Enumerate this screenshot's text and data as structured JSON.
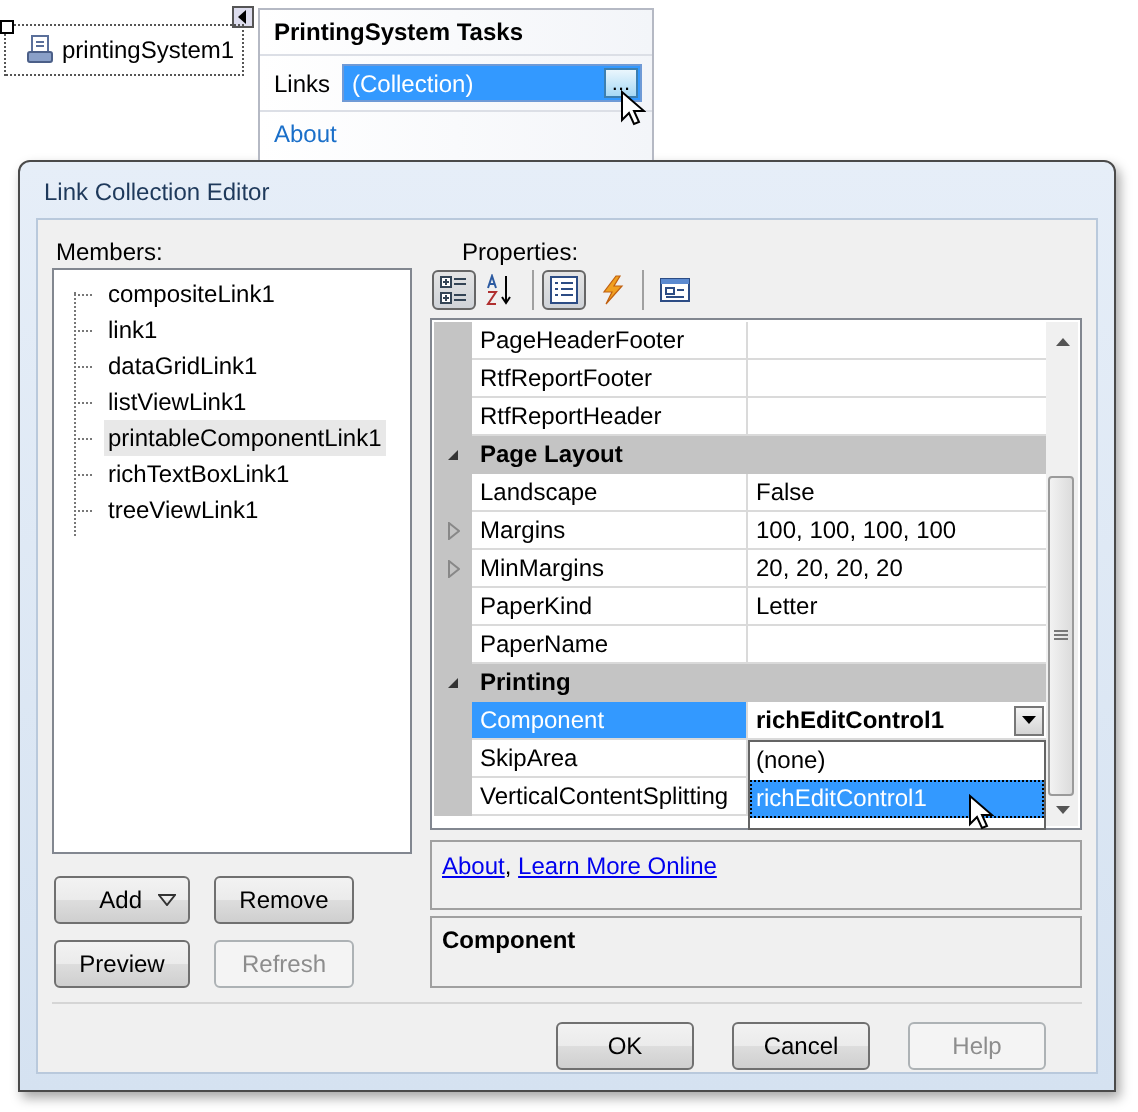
{
  "component_tray": {
    "label": "printingSystem1"
  },
  "smart_tag": {
    "title": "PrintingSystem Tasks",
    "links_label": "Links",
    "links_value": "(Collection)",
    "ellipsis": "...",
    "about_link": "About"
  },
  "dialog": {
    "title": "Link Collection Editor",
    "members_label": "Members:",
    "members": [
      {
        "label": "compositeLink1",
        "selected": false
      },
      {
        "label": "link1",
        "selected": false
      },
      {
        "label": "dataGridLink1",
        "selected": false
      },
      {
        "label": "listViewLink1",
        "selected": false
      },
      {
        "label": "printableComponentLink1",
        "selected": true
      },
      {
        "label": "richTextBoxLink1",
        "selected": false
      },
      {
        "label": "treeViewLink1",
        "selected": false
      }
    ],
    "member_buttons": [
      {
        "label": "Add",
        "kind": "split",
        "disabled": false
      },
      {
        "label": "Remove",
        "kind": "plain",
        "disabled": false
      },
      {
        "label": "Preview",
        "kind": "plain",
        "disabled": false
      },
      {
        "label": "Refresh",
        "kind": "plain",
        "disabled": true
      }
    ],
    "properties_label": "Properties:",
    "toolbar": [
      {
        "kind": "categorized",
        "selected": true
      },
      {
        "kind": "alphabetical",
        "selected": false
      },
      {
        "kind": "properties",
        "selected": true
      },
      {
        "kind": "events",
        "selected": false
      },
      {
        "kind": "property-pages",
        "selected": false
      }
    ],
    "grid": {
      "rows": [
        {
          "kind": "property",
          "name": "PageHeaderFooter",
          "expandable": false,
          "selected": false
        },
        {
          "kind": "property",
          "name": "RtfReportFooter",
          "expandable": false,
          "selected": false
        },
        {
          "kind": "property",
          "name": "RtfReportHeader",
          "expandable": false,
          "selected": false
        },
        {
          "kind": "category",
          "name": "Page Layout",
          "expanded": true
        },
        {
          "kind": "property",
          "name": "Landscape",
          "value": "False",
          "expandable": false,
          "selected": false,
          "modified": false
        },
        {
          "kind": "property",
          "name": "Margins",
          "value": "100, 100, 100, 100",
          "expandable": true,
          "selected": false,
          "modified": false
        },
        {
          "kind": "property",
          "name": "MinMargins",
          "value": "20, 20, 20, 20",
          "expandable": true,
          "selected": false,
          "modified": false
        },
        {
          "kind": "property",
          "name": "PaperKind",
          "value": "Letter",
          "expandable": false,
          "selected": false,
          "modified": false
        },
        {
          "kind": "property",
          "name": "PaperName",
          "expandable": false,
          "selected": false
        },
        {
          "kind": "category",
          "name": "Printing",
          "expanded": true
        },
        {
          "kind": "property",
          "name": "Component",
          "value": "richEditControl1",
          "expandable": false,
          "selected": true,
          "modified": true
        },
        {
          "kind": "property",
          "name": "SkipArea",
          "expandable": false,
          "selected": false
        },
        {
          "kind": "property",
          "name": "VerticalContentSplitting",
          "expandable": false,
          "selected": false
        }
      ],
      "dropdown": [
        {
          "label": "(none)",
          "selected": false
        },
        {
          "label": "richEditControl1",
          "selected": true
        }
      ]
    },
    "command_links": [
      "About",
      "Learn More Online"
    ],
    "command_separator": ",",
    "description": {
      "title": "Component"
    },
    "footer_buttons": [
      {
        "label": "OK",
        "disabled": false
      },
      {
        "label": "Cancel",
        "disabled": false
      },
      {
        "label": "Help",
        "disabled": true
      }
    ]
  }
}
